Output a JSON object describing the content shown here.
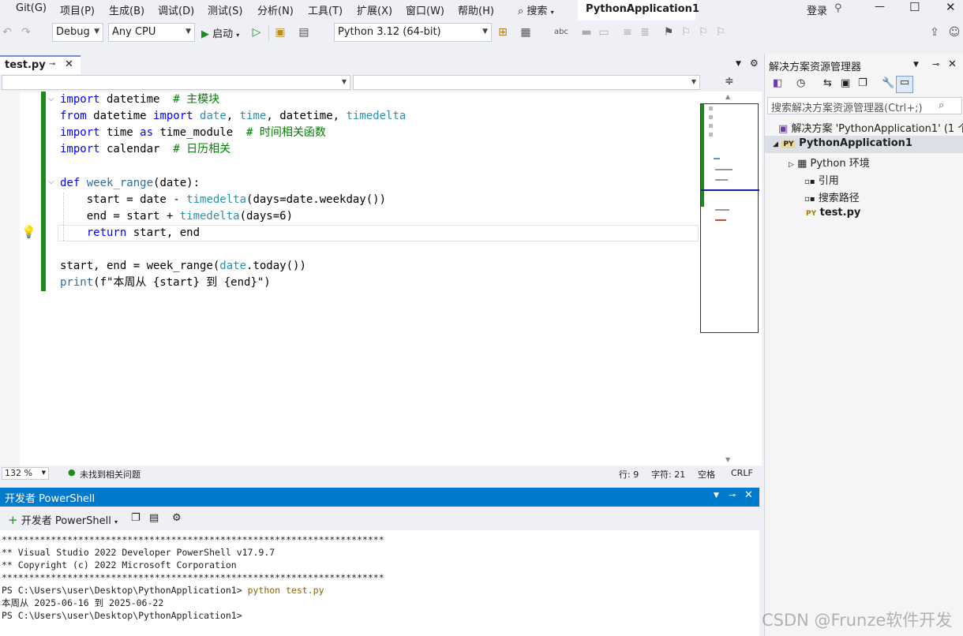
{
  "menubar": {
    "items": [
      "Git(G)",
      "项目(P)",
      "生成(B)",
      "调试(D)",
      "测试(S)",
      "分析(N)",
      "工具(T)",
      "扩展(X)",
      "窗口(W)",
      "帮助(H)"
    ],
    "search_label": "搜索",
    "solution_title": "PythonApplication1",
    "login_label": "登录"
  },
  "toolbar": {
    "config": "Debug",
    "platform": "Any CPU",
    "start_label": "启动",
    "interpreter": "Python 3.12 (64-bit)"
  },
  "editor": {
    "tab_name": "test.py",
    "zoom": "132 %",
    "issues_text": "未找到相关问题",
    "line_info": "行: 9",
    "char_info": "字符: 21",
    "whitespace": "空格",
    "line_ending": "CRLF",
    "code": {
      "l1": {
        "kw": "import",
        "mod": " datetime  ",
        "cm": "# 主模块"
      },
      "l2": {
        "kw1": "from",
        "mod": " datetime ",
        "kw2": "import",
        "ty1": "date",
        "sep1": ", ",
        "ty2": "time",
        "sep2": ", ",
        "ty3": "datetime",
        "sep3": ", ",
        "ty4": "timedelta"
      },
      "l3": {
        "kw1": "import",
        "mid": " time ",
        "kw2": "as",
        "alias": " time_module  ",
        "cm": "# 时间相关函数"
      },
      "l4": {
        "kw": "import",
        "mod": " calendar  ",
        "cm": "# 日历相关"
      },
      "l6": {
        "kw": "def",
        "fn": "week_range",
        "rest": "(date):"
      },
      "l7": {
        "a": "    start = date - ",
        "ty": "timedelta",
        "b": "(days=date.weekday())"
      },
      "l8": {
        "a": "    end = start + ",
        "ty": "timedelta",
        "b": "(days=6)"
      },
      "l9": {
        "kw": "    return",
        "rest": " start, end"
      },
      "l11": {
        "a": "start, end = week_range(",
        "ty": "date",
        "b": ".today())"
      },
      "l12": {
        "fn": "print",
        "rest": "(f\"本周从 {start} 到 {end}\")"
      }
    }
  },
  "powershell": {
    "title": "开发者 PowerShell",
    "new_label": "开发者 PowerShell",
    "lines": [
      "**********************************************************************",
      "** Visual Studio 2022 Developer PowerShell v17.9.7",
      "** Copyright (c) 2022 Microsoft Corporation",
      "**********************************************************************",
      "PS C:\\Users\\user\\Desktop\\PythonApplication1> ",
      "本周从 2025-06-16 到 2025-06-22",
      "PS C:\\Users\\user\\Desktop\\PythonApplication1>"
    ],
    "command": "python test.py"
  },
  "solution_explorer": {
    "title": "解决方案资源管理器",
    "search_placeholder": "搜索解决方案资源管理器(Ctrl+;)",
    "solution": "解决方案 'PythonApplication1' (1 个",
    "project": "PythonApplication1",
    "items": [
      "Python 环境",
      "引用",
      "搜索路径",
      "test.py"
    ],
    "py_badge": "PY"
  },
  "watermark": "CSDN @Frunze软件开发"
}
